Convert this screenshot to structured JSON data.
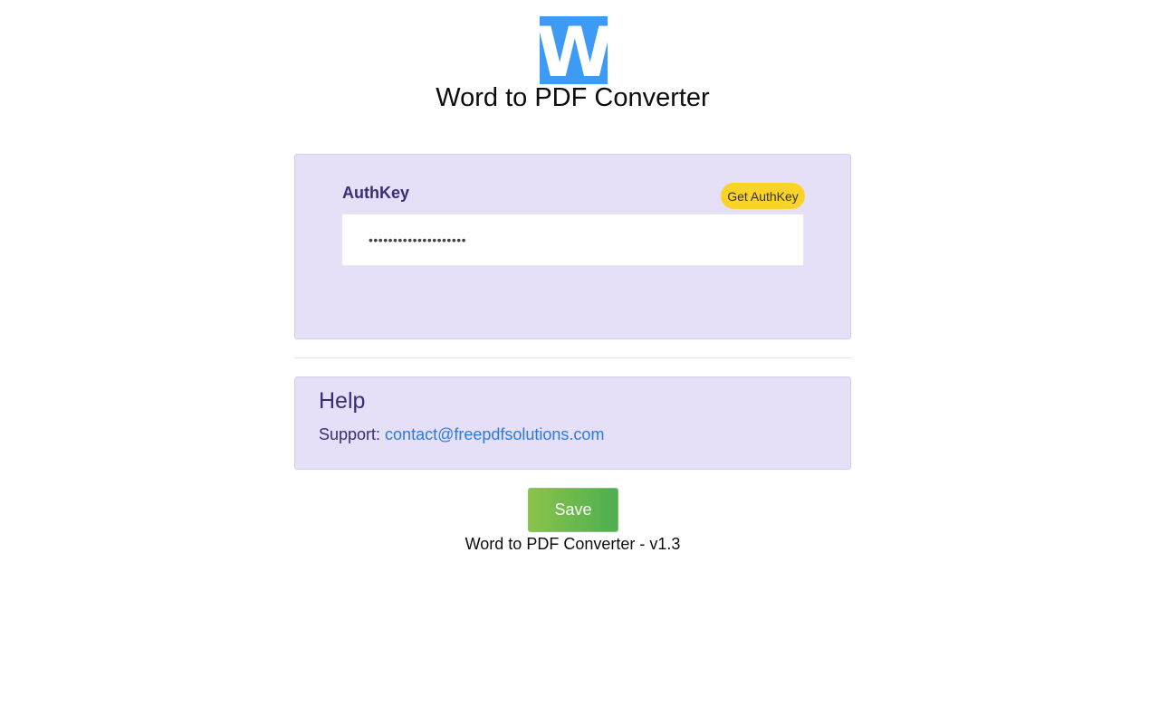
{
  "header": {
    "logo_letter": "W",
    "title": "Word to PDF Converter"
  },
  "auth": {
    "label": "AuthKey",
    "get_key_label": "Get AuthKey",
    "value": "••••••••••••••••••••"
  },
  "help": {
    "title": "Help",
    "support_label": "Support: ",
    "support_email": "contact@freepdfsolutions.com"
  },
  "footer": {
    "save_label": "Save",
    "version": "Word to PDF Converter - v1.3"
  },
  "colors": {
    "logo": "#3d9af5",
    "panel": "#e5dff7",
    "accent_text": "#3a2e72",
    "link": "#2a7ae4",
    "get_key_button": "#fbd227",
    "save_gradient_start": "#8bc34a",
    "save_gradient_end": "#4caf50"
  }
}
